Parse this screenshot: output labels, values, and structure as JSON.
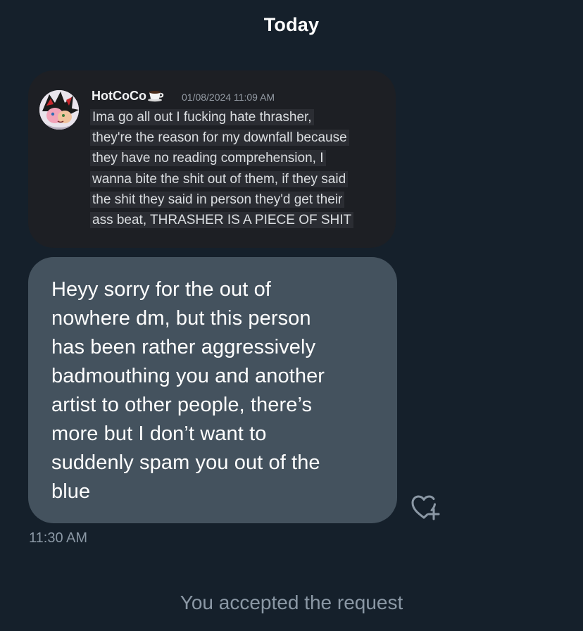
{
  "header": {
    "day_label": "Today"
  },
  "embed": {
    "username": "HotCoCo",
    "username_icon": "coffee-cup-icon",
    "timestamp": "01/08/2024 11:09 AM",
    "avatar_icon": "cartoon-character-avatar",
    "body_lines": [
      "Ima go all out I fucking hate thrasher,",
      "they're the reason for my downfall because",
      "they have no reading comprehension, I",
      "wanna bite the shit out of them, if they said",
      "the shit they said in person they'd get their",
      "ass beat, THRASHER IS A PIECE OF SHIT"
    ]
  },
  "message": {
    "lines": [
      "Heyy sorry for the out of",
      "nowhere dm, but this person",
      "has been rather aggressively",
      "badmouthing you and another",
      "artist to other people, there’s",
      "more but I don’t want to",
      "suddenly spam you out of the",
      "blue"
    ],
    "time": "11:30 AM",
    "react_icon": "heart-plus-icon"
  },
  "footer": {
    "system_note": "You accepted the request"
  },
  "colors": {
    "background": "#15202b",
    "bubble": "#44525e",
    "embed_card": "#1d1f24",
    "muted_text": "#8b98a5"
  }
}
